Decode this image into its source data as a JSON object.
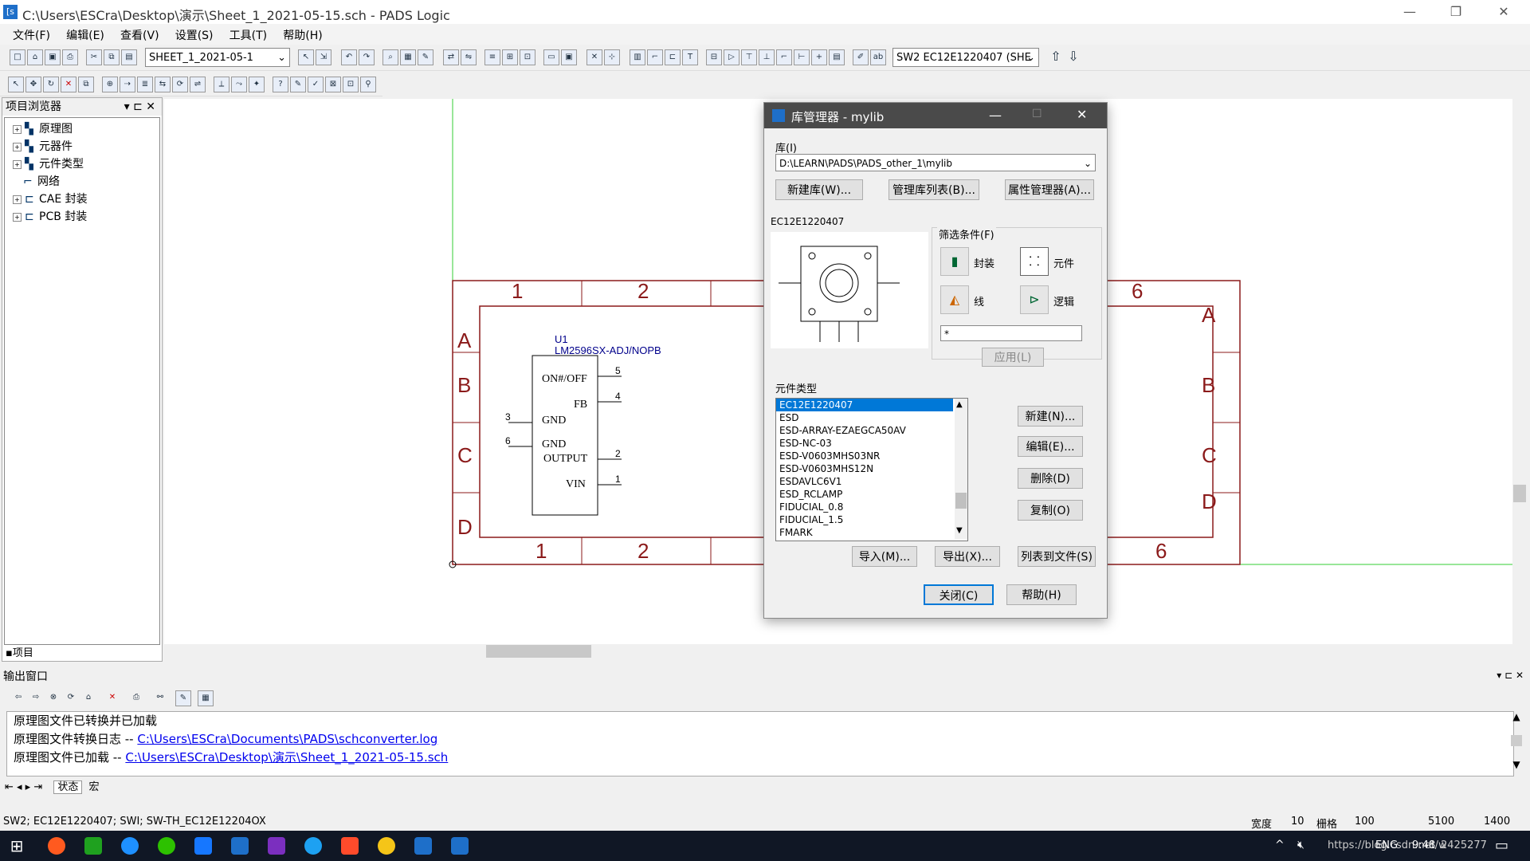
{
  "window": {
    "title": "C:\\Users\\ESCra\\Desktop\\演示\\Sheet_1_2021-05-15.sch - PADS Logic",
    "icon_label": "[s"
  },
  "menu": [
    "文件(F)",
    "编辑(E)",
    "查看(V)",
    "设置(S)",
    "工具(T)",
    "帮助(H)"
  ],
  "toolbar": {
    "sheet_combo": "SHEET_1_2021-05-1",
    "part_combo": "SW2 EC12E1220407 (SHE"
  },
  "project_browser": {
    "title": "项目浏览器",
    "items": [
      "原理图",
      "元器件",
      "元件类型",
      "网络",
      "CAE 封装",
      "PCB 封装"
    ],
    "tab": "项目"
  },
  "schematic": {
    "border_top_numbers": [
      "1",
      "2",
      "6"
    ],
    "border_bottom_numbers": [
      "1",
      "2",
      "6"
    ],
    "border_left_letters": [
      "A",
      "B",
      "C",
      "D"
    ],
    "border_right_letters": [
      "A",
      "B",
      "C",
      "D"
    ],
    "part": {
      "ref": "U1",
      "value": "LM2596SX-ADJ/NOPB",
      "pins_right": [
        {
          "name": "ON#/OFF",
          "num": "5"
        },
        {
          "name": "FB",
          "num": "4"
        },
        {
          "name": "OUTPUT",
          "num": "2"
        },
        {
          "name": "VIN",
          "num": "1"
        }
      ],
      "pins_left": [
        {
          "name": "GND",
          "num": "3"
        },
        {
          "name": "GND",
          "num": "6"
        }
      ]
    }
  },
  "library_manager": {
    "title": "库管理器 - mylib",
    "library_label": "库(I)",
    "library_path": "D:\\LEARN\\PADS\\PADS_other_1\\mylib",
    "buttons_top": [
      "新建库(W)...",
      "管理库列表(B)...",
      "属性管理器(A)..."
    ],
    "preview_label": "EC12E1220407",
    "filter": {
      "label": "筛选条件(F)",
      "options": [
        "封装",
        "元件",
        "线",
        "逻辑"
      ],
      "input_value": "*",
      "apply": "应用(L)"
    },
    "list_label": "元件类型",
    "list_items": [
      "EC12E1220407",
      "ESD",
      "ESD-ARRAY-EZAEGCA50AV",
      "ESD-NC-03",
      "ESD-V0603MHS03NR",
      "ESD-V0603MHS12N",
      "ESDAVLC6V1",
      "ESD_RCLAMP",
      "FIDUCIAL_0.8",
      "FIDUCIAL_1.5",
      "FMARK"
    ],
    "selected_index": 0,
    "side_buttons": [
      "新建(N)...",
      "编辑(E)...",
      "删除(D)",
      "复制(O)"
    ],
    "bottom_buttons": [
      "导入(M)...",
      "导出(X)...",
      "列表到文件(S)"
    ],
    "close": "关闭(C)",
    "help": "帮助(H)"
  },
  "output": {
    "title": "输出窗口",
    "lines": [
      {
        "text": "原理图文件已转换并已加载",
        "link": ""
      },
      {
        "text": "原理图文件转换日志  -- ",
        "link": "C:\\Users\\ESCra\\Documents\\PADS\\schconverter.log"
      },
      {
        "text": "原理图文件已加载  -- ",
        "link": "C:\\Users\\ESCra\\Desktop\\演示\\Sheet_1_2021-05-15.sch"
      }
    ],
    "tabs": [
      "状态",
      "宏"
    ]
  },
  "status": {
    "text": "SW2; EC12E1220407; SWI; SW-TH_EC12E12204OX",
    "width_label": "宽度",
    "width_value": "10",
    "grid_label": "栅格",
    "grid_value": "100",
    "x": "5100",
    "y": "1400"
  },
  "taskbar": {
    "lang": "ENG",
    "url_fragment": "https://blog.csdn.net/w",
    "time": "9:48",
    "suffix": "2425277"
  }
}
